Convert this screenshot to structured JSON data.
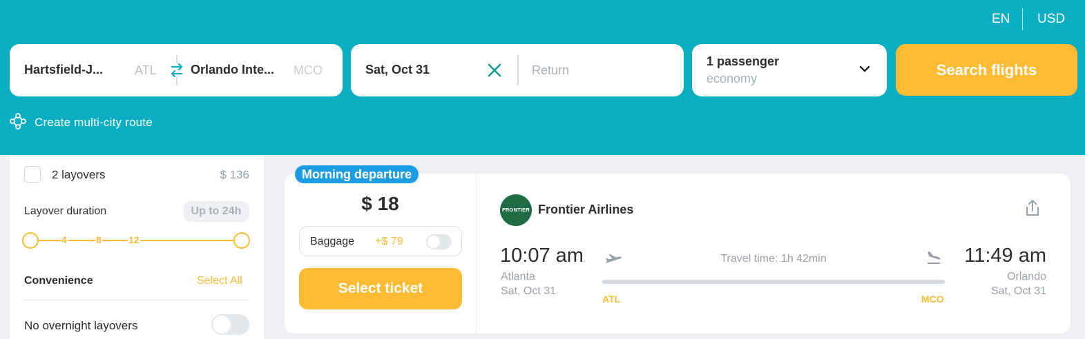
{
  "header": {
    "language": "EN",
    "currency": "USD",
    "route": {
      "from_name": "Hartsfield-J...",
      "from_code": "ATL",
      "to_name": "Orlando Inte...",
      "to_code": "MCO",
      "swap_icon": "swap-arrows-icon"
    },
    "dates": {
      "departure": "Sat, Oct 31",
      "return_placeholder": "Return",
      "clear_icon": "close-icon"
    },
    "passengers": {
      "count": "1 passenger",
      "cabin_class": "economy",
      "dropdown_icon": "chevron-down-icon"
    },
    "search_label": "Search flights",
    "multi_city_label": "Create multi-city route",
    "multi_city_icon": "route-nodes-icon"
  },
  "filters": {
    "two_layovers": {
      "label": "2 layovers",
      "price": "$ 136",
      "checked": false
    },
    "layover_duration": {
      "label": "Layover duration",
      "badge": "Up to 24h",
      "ticks": [
        "4",
        "8",
        "12"
      ],
      "range_hours": [
        0,
        24
      ]
    },
    "convenience": {
      "label": "Convenience",
      "select_all": "Select All",
      "no_overnight_label": "No overnight layovers",
      "no_overnight_on": false
    }
  },
  "ticket": {
    "badge": "Morning departure",
    "price": "$ 18",
    "baggage_label": "Baggage",
    "baggage_price": "+$ 79",
    "baggage_on": false,
    "select_label": "Select ticket",
    "airline": {
      "name": "Frontier Airlines",
      "logo_text": "FRONTIER"
    },
    "share_icon": "share-icon",
    "departure": {
      "time": "10:07 am",
      "city": "Atlanta",
      "date": "Sat, Oct 31",
      "code": "ATL",
      "icon": "takeoff-icon"
    },
    "arrival": {
      "time": "11:49 am",
      "city": "Orlando",
      "date": "Sat, Oct 31",
      "code": "MCO",
      "icon": "landing-icon"
    },
    "travel_time": "Travel time: 1h 42min"
  },
  "colors": {
    "header_bg": "#0aaec2",
    "accent": "#ffbb33",
    "badge_blue": "#1c9ce3",
    "airline_logo": "#1f6b43",
    "page_bg": "#eef0f3"
  }
}
